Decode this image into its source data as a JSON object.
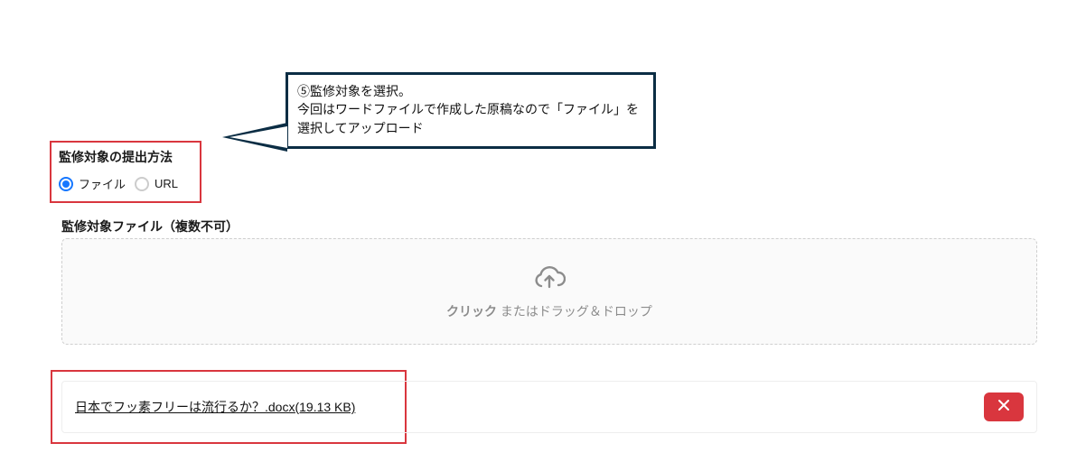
{
  "callout": {
    "line1": "⑤監修対象を選択。",
    "line2": "今回はワードファイルで作成した原稿なので「ファイル」を選択してアップロード"
  },
  "selection": {
    "label": "監修対象の提出方法",
    "option_file": "ファイル",
    "option_url": "URL"
  },
  "file_section": {
    "label": "監修対象ファイル（複数不可）"
  },
  "dropzone": {
    "click": "クリック",
    "rest": " またはドラッグ＆ドロップ"
  },
  "uploaded_file": {
    "name": "日本でフッ素フリーは流行るか？.docx",
    "size": "(19.13 KB)"
  }
}
